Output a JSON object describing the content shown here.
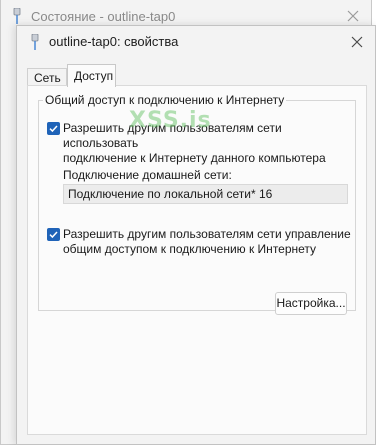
{
  "back_window": {
    "title": "Состояние - outline-tap0",
    "icons": {
      "app": "network-adapter-icon",
      "close": "close-icon"
    }
  },
  "dialog": {
    "title": "outline-tap0: свойства",
    "icons": {
      "app": "network-adapter-icon",
      "close": "close-icon"
    },
    "tabs": [
      {
        "label": "Сеть",
        "active": false
      },
      {
        "label": "Доступ",
        "active": true
      }
    ],
    "sharing": {
      "group_title": "Общий доступ к подключению к Интернету",
      "allow_share": {
        "checked": true,
        "label_line1": "Разрешить другим пользователям сети использовать",
        "label_line2": "подключение к Интернету данного компьютера"
      },
      "home_network_label": "Подключение домашней сети:",
      "home_network_value": "Подключение по локальной сети* 16",
      "allow_control": {
        "checked": true,
        "label_line1": "Разрешить другим пользователям сети управление",
        "label_line2": "общим доступом к подключению к Интернету"
      },
      "settings_button": "Настройка..."
    },
    "watermark": "XSS.is"
  },
  "colors": {
    "checkbox": "#1f63b8",
    "watermark": "#5bbf5b"
  }
}
